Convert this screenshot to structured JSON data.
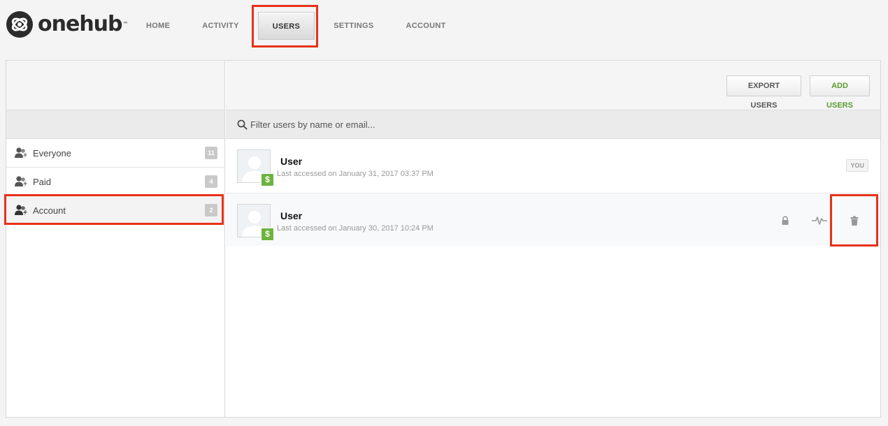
{
  "app": {
    "name": "onehub",
    "tm": "™"
  },
  "nav": {
    "items": [
      {
        "label": "HOME"
      },
      {
        "label": "ACTIVITY"
      },
      {
        "label": "USERS",
        "active": true
      },
      {
        "label": "SETTINGS"
      },
      {
        "label": "ACCOUNT"
      }
    ]
  },
  "toolbar": {
    "export_label": "EXPORT USERS",
    "add_label": "ADD USERS"
  },
  "filter": {
    "placeholder": "Filter users by name or email..."
  },
  "sidebar": {
    "items": [
      {
        "label": "Everyone",
        "count": "11"
      },
      {
        "label": "Paid",
        "count": "4"
      },
      {
        "label": "Account",
        "count": "2",
        "selected": true
      }
    ]
  },
  "users": [
    {
      "name": "User",
      "meta": "Last accessed on January 31, 2017 03:37 PM",
      "badge": "YOU",
      "plan_symbol": "$"
    },
    {
      "name": "User",
      "meta": "Last accessed on January 30, 2017 10:24 PM",
      "plan_symbol": "$"
    }
  ],
  "colors": {
    "accent_green": "#6cb33f",
    "highlight_red": "#e8311a"
  },
  "icons": {
    "logo": "onehub-logo-icon",
    "group": "users-group-icon",
    "search": "search-icon",
    "lock": "lock-icon",
    "activity": "activity-pulse-icon",
    "trash": "trash-icon"
  }
}
